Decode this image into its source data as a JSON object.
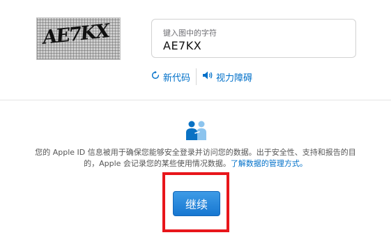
{
  "captcha": {
    "text": "AE7KX"
  },
  "input": {
    "label": "键入图中的字符",
    "value": "AE7KX"
  },
  "links": {
    "new_code": "新代码",
    "vision": "视力障碍"
  },
  "info": {
    "text": "您的 Apple ID 信息被用于确保您能够安全登录并访问您的数据。出于安全性、支持和报告的目的，Apple 会记录您的某些使用情况数据。",
    "link": "了解数据的管理方式。"
  },
  "continue_label": "继续",
  "colors": {
    "accent": "#0070c9",
    "highlight": "#e8161b",
    "button": "#1777d1"
  }
}
